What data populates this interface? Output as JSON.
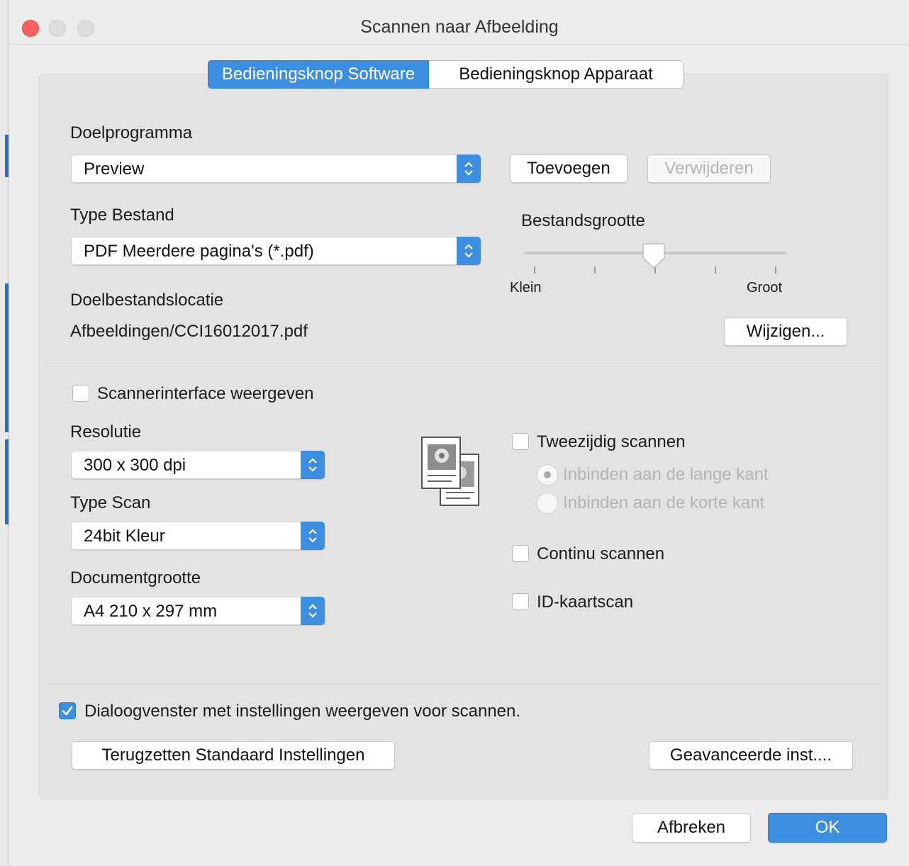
{
  "window": {
    "title": "Scannen naar Afbeelding"
  },
  "tabs": [
    {
      "label": "Bedieningsknop Software",
      "active": true
    },
    {
      "label": "Bedieningsknop Apparaat",
      "active": false
    }
  ],
  "target_app": {
    "label": "Doelprogramma",
    "value": "Preview",
    "add_label": "Toevoegen",
    "remove_label": "Verwijderen"
  },
  "file_type": {
    "label": "Type Bestand",
    "value": "PDF Meerdere pagina's (*.pdf)"
  },
  "file_size": {
    "label": "Bestandsgrootte",
    "min_label": "Klein",
    "max_label": "Groot",
    "level": 0.5
  },
  "destination": {
    "label": "Doelbestandslocatie",
    "path": "Afbeeldingen/CCI16012017.pdf",
    "change_label": "Wijzigen..."
  },
  "scanner_interface": {
    "label": "Scannerinterface weergeven",
    "checked": false
  },
  "resolution": {
    "label": "Resolutie",
    "value": "300 x 300 dpi"
  },
  "scan_type": {
    "label": "Type Scan",
    "value": "24bit Kleur"
  },
  "document_size": {
    "label": "Documentgrootte",
    "value": "A4 210 x 297 mm"
  },
  "duplex": {
    "label": "Tweezijdig scannen",
    "checked": false,
    "long_edge": "Inbinden aan de lange kant",
    "short_edge": "Inbinden aan de korte kant"
  },
  "continuous": {
    "label": "Continu scannen",
    "checked": false
  },
  "id_card": {
    "label": "ID-kaartscan",
    "checked": false
  },
  "show_dialog": {
    "label": "Dialoogvenster met instellingen weergeven voor scannen.",
    "checked": true
  },
  "buttons": {
    "reset": "Terugzetten Standaard Instellingen",
    "advanced": "Geavanceerde inst....",
    "cancel": "Afbreken",
    "ok": "OK"
  },
  "colors": {
    "accent": "#3d8de0",
    "close": "#fc605c"
  }
}
